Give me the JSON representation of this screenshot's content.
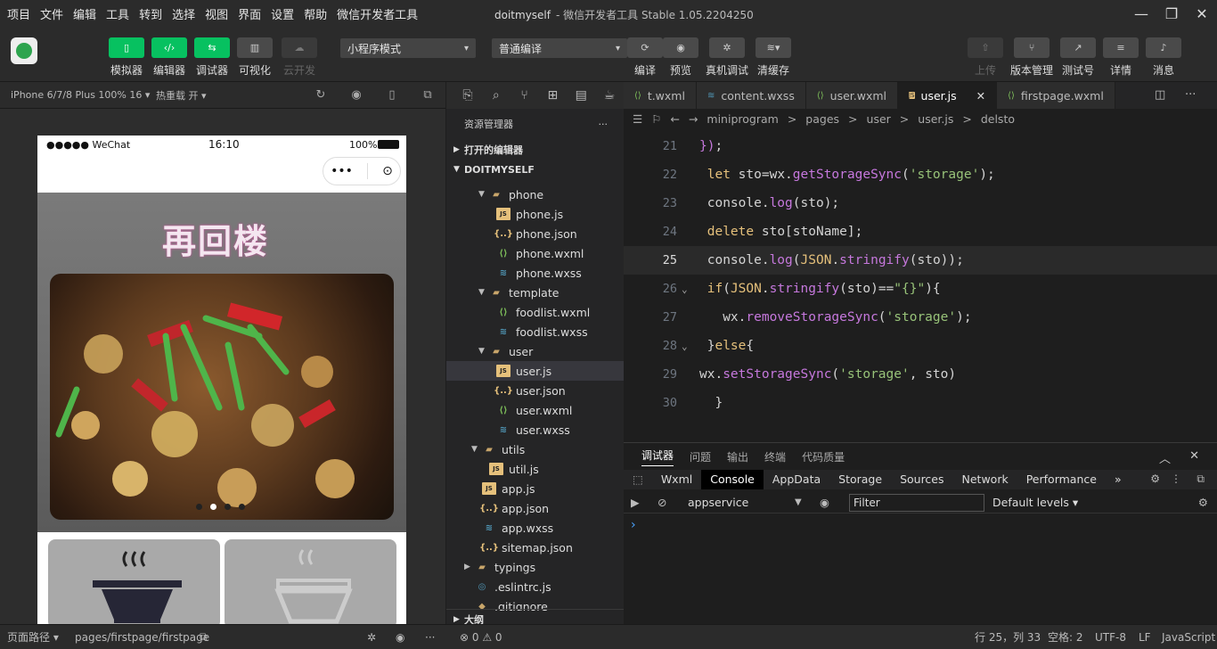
{
  "menu": [
    "项目",
    "文件",
    "编辑",
    "工具",
    "转到",
    "选择",
    "视图",
    "界面",
    "设置",
    "帮助",
    "微信开发者工具"
  ],
  "window": {
    "project": "doitmyself",
    "title": "- 微信开发者工具 Stable 1.05.2204250"
  },
  "toolbar": {
    "buttons": [
      {
        "label": "模拟器",
        "icon": "phone-icon"
      },
      {
        "label": "编辑器",
        "icon": "code-icon"
      },
      {
        "label": "调试器",
        "icon": "debug-icon"
      },
      {
        "label": "可视化",
        "icon": "layout-icon"
      },
      {
        "label": "云开发",
        "icon": "cloud-icon"
      }
    ],
    "mode_select": "小程序模式",
    "compile_select": "普通编译",
    "actions": [
      {
        "label": "编译",
        "icon": "refresh-icon"
      },
      {
        "label": "预览",
        "icon": "eye-icon"
      },
      {
        "label": "真机调试",
        "icon": "bug-icon"
      },
      {
        "label": "清缓存",
        "icon": "layers-icon"
      }
    ],
    "right": [
      {
        "label": "上传",
        "icon": "upload-icon"
      },
      {
        "label": "版本管理",
        "icon": "branch-icon"
      },
      {
        "label": "测试号",
        "icon": "link-icon"
      },
      {
        "label": "详情",
        "icon": "menu-icon"
      },
      {
        "label": "消息",
        "icon": "bell-icon"
      }
    ]
  },
  "simulator": {
    "device": "iPhone 6/7/8 Plus 100% 16 ▾",
    "hotreload": "热重载 开 ▾",
    "status": {
      "carrier": "●●●●● WeChat",
      "time": "16:10",
      "battery": "100%"
    },
    "capsule": {
      "more": "•••",
      "close": "⊙"
    },
    "title": "再回楼"
  },
  "explorer": {
    "header": "资源管理器",
    "open_editors": "打开的编辑器",
    "project": "DOITMYSELF",
    "tree": [
      {
        "name": "phone",
        "type": "folder",
        "indent": 36,
        "open": true
      },
      {
        "name": "phone.js",
        "type": "js",
        "indent": 56
      },
      {
        "name": "phone.json",
        "type": "json",
        "indent": 56
      },
      {
        "name": "phone.wxml",
        "type": "wxml",
        "indent": 56
      },
      {
        "name": "phone.wxss",
        "type": "wxss",
        "indent": 56
      },
      {
        "name": "template",
        "type": "folder",
        "indent": 36,
        "open": true
      },
      {
        "name": "foodlist.wxml",
        "type": "wxml",
        "indent": 56
      },
      {
        "name": "foodlist.wxss",
        "type": "wxss",
        "indent": 56
      },
      {
        "name": "user",
        "type": "folder",
        "indent": 36,
        "open": true
      },
      {
        "name": "user.js",
        "type": "js",
        "indent": 56,
        "selected": true
      },
      {
        "name": "user.json",
        "type": "json",
        "indent": 56
      },
      {
        "name": "user.wxml",
        "type": "wxml",
        "indent": 56
      },
      {
        "name": "user.wxss",
        "type": "wxss",
        "indent": 56
      },
      {
        "name": "utils",
        "type": "folder",
        "indent": 28,
        "open": true
      },
      {
        "name": "util.js",
        "type": "js",
        "indent": 48
      },
      {
        "name": "app.js",
        "type": "js",
        "indent": 40
      },
      {
        "name": "app.json",
        "type": "json",
        "indent": 40
      },
      {
        "name": "app.wxss",
        "type": "wxss",
        "indent": 40
      },
      {
        "name": "sitemap.json",
        "type": "json",
        "indent": 40
      },
      {
        "name": "typings",
        "type": "folder",
        "indent": 20,
        "open": false
      },
      {
        "name": ".eslintrc.js",
        "type": "eslint",
        "indent": 32
      },
      {
        "name": ".gitignore",
        "type": "git",
        "indent": 32
      }
    ],
    "outline": "大纲"
  },
  "tabs": [
    {
      "name": "t.wxml",
      "type": "wxml"
    },
    {
      "name": "content.wxss",
      "type": "wxss"
    },
    {
      "name": "user.wxml",
      "type": "wxml"
    },
    {
      "name": "user.js",
      "type": "js",
      "active": true
    },
    {
      "name": "firstpage.wxml",
      "type": "wxml"
    }
  ],
  "breadcrumb": [
    "miniprogram",
    ">",
    "pages",
    ">",
    "user",
    ">",
    "user.js",
    ">",
    "delsto"
  ],
  "code": [
    {
      "n": "21",
      "html": "<span class='pl'>})</span>;"
    },
    {
      "n": "22",
      "html": " <span class='kw'>let</span> sto=wx.<span class='fn'>getStorageSync</span>(<span class='str'>'storage'</span>);"
    },
    {
      "n": "23",
      "html": " console.<span class='fn'>log</span>(sto);"
    },
    {
      "n": "24",
      "html": " <span class='kw'>delete</span> sto[stoName];"
    },
    {
      "n": "25",
      "html": " console.<span class='fn'>log</span>(<span class='kw'>JSON</span>.<span class='fn'>stringify</span>(sto));",
      "cur": true
    },
    {
      "n": "26",
      "html": " <span class='kw'>if</span>(<span class='kw'>JSON</span>.<span class='fn'>stringify</span>(sto)==<span class='str'>\"{}\"</span>){"
    },
    {
      "n": "27",
      "html": "   wx.<span class='fn'>removeStorageSync</span>(<span class='str'>'storage'</span>);"
    },
    {
      "n": "28",
      "html": " }<span class='kw'>else</span>{"
    },
    {
      "n": "29",
      "html": "wx.<span class='fn'>setStorageSync</span>(<span class='str'>'storage'</span>, sto)"
    },
    {
      "n": "30",
      "html": "  }"
    }
  ],
  "panel": {
    "tabs": [
      "调试器",
      "问题",
      "输出",
      "终端",
      "代码质量"
    ],
    "devtabs": [
      "Wxml",
      "Console",
      "AppData",
      "Storage",
      "Sources",
      "Network",
      "Performance",
      "»"
    ],
    "context": "appservice",
    "filter_placeholder": "Filter",
    "levels": "Default levels ▾",
    "prompt": "›"
  },
  "status": {
    "path_label": "页面路径 ▾",
    "path": "pages/firstpage/firstpage",
    "errors": "⊗ 0 ⚠ 0",
    "cursor": "行 25，列 33",
    "spaces": "空格: 2",
    "encoding": "UTF-8",
    "eol": "LF",
    "language": "JavaScript"
  }
}
